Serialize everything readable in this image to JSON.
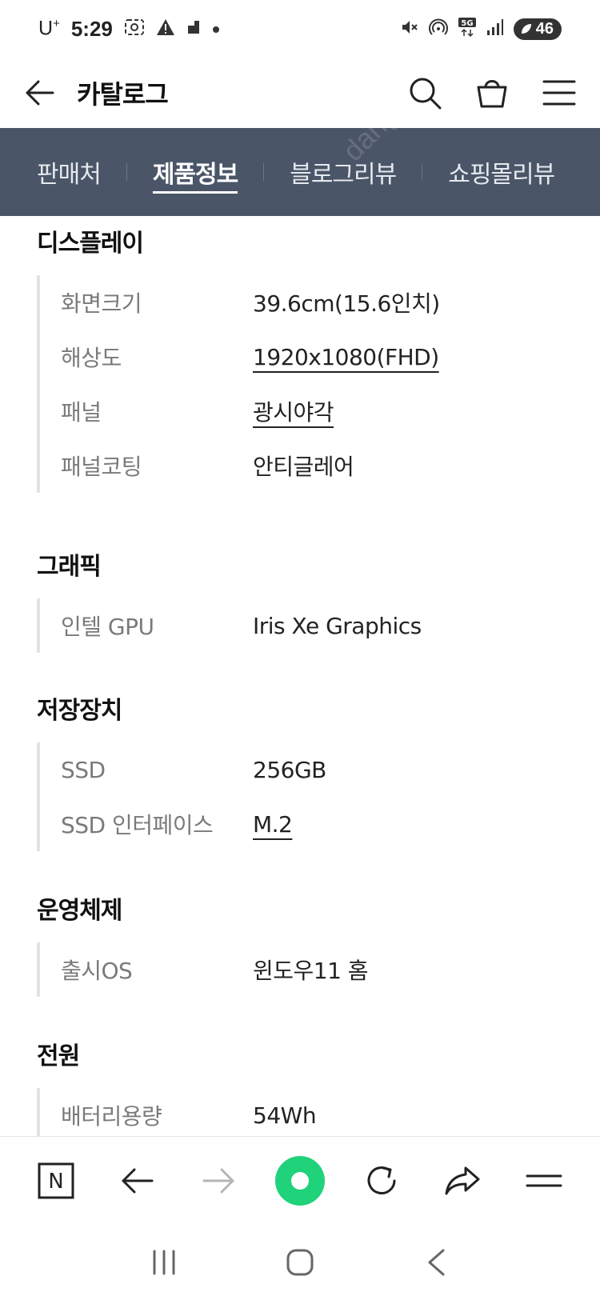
{
  "status_bar": {
    "carrier": "U",
    "carrier_sup": "+",
    "time": "5:29",
    "battery": "46"
  },
  "header": {
    "title": "카탈로그"
  },
  "tabs": [
    {
      "label": "판매처"
    },
    {
      "label": "제품정보"
    },
    {
      "label": "블로그리뷰"
    },
    {
      "label": "쇼핑몰리뷰"
    }
  ],
  "watermark": "danggeong",
  "sections": [
    {
      "title": "디스플레이",
      "rows": [
        {
          "label": "화면크기",
          "value": "39.6cm(15.6인치)"
        },
        {
          "label": "해상도",
          "value": "1920x1080(FHD)"
        },
        {
          "label": "패널",
          "value": "광시야각"
        },
        {
          "label": "패널코팅",
          "value": "안티글레어"
        }
      ]
    },
    {
      "title": "그래픽",
      "rows": [
        {
          "label": "인텔 GPU",
          "value": "Iris Xe Graphics"
        }
      ]
    },
    {
      "title": "저장장치",
      "rows": [
        {
          "label": "SSD",
          "value": "256GB"
        },
        {
          "label": "SSD 인터페이스",
          "value": "M.2"
        }
      ]
    },
    {
      "title": "운영체제",
      "rows": [
        {
          "label": "출시OS",
          "value": "윈도우11 홈"
        }
      ]
    },
    {
      "title": "전원",
      "rows": [
        {
          "label": "배터리용량",
          "value": "54Wh"
        }
      ]
    }
  ],
  "bottom_toolbar": {
    "n_label": "N"
  },
  "colors": {
    "tabbar_bg": "#4a5568",
    "home_green": "#20d27a"
  }
}
